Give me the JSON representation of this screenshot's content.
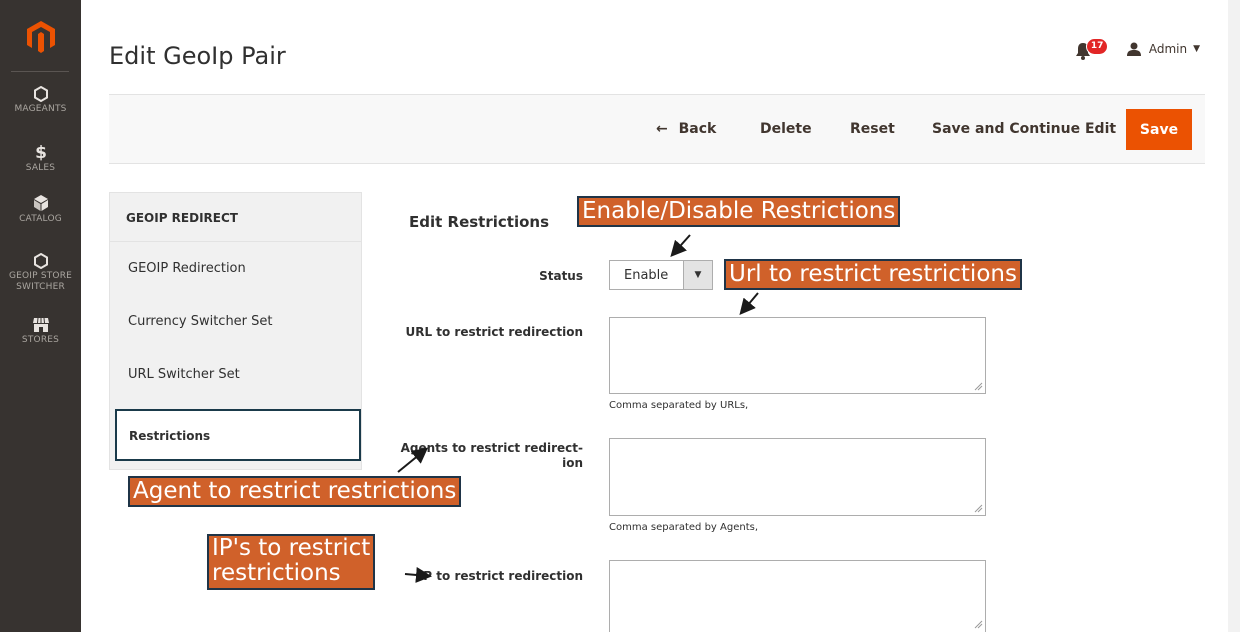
{
  "sidebar_nav": {
    "items": [
      {
        "label": "MAGEANTS",
        "icon": "hexagon-icon"
      },
      {
        "label": "SALES",
        "icon": "dollar-icon"
      },
      {
        "label": "CATALOG",
        "icon": "cube-icon"
      },
      {
        "label": "GEOIP STORE SWITCHER",
        "line1": "GEOIP STORE",
        "line2": "SWITCHER",
        "icon": "hexagon-icon"
      },
      {
        "label": "STORES",
        "icon": "store-icon"
      }
    ]
  },
  "header": {
    "title": "Edit GeoIp Pair",
    "notifications_count": "17",
    "user": "Admin"
  },
  "actions": {
    "back": "Back",
    "delete": "Delete",
    "reset": "Reset",
    "save_continue": "Save and Continue Edit",
    "save": "Save"
  },
  "tabs": {
    "heading": "GEOIP REDIRECT",
    "items": [
      "GEOIP Redirection",
      "Currency Switcher Set",
      "URL Switcher Set",
      "Restrictions"
    ],
    "active": "Restrictions"
  },
  "form": {
    "section_title": "Edit Restrictions",
    "status_label": "Status",
    "status_value": "Enable",
    "url_label": "URL to restrict redirection",
    "url_note": "Comma separated by URLs,",
    "agents_label_line1": "Agents to restrict redirect-",
    "agents_label_line2": "ion",
    "agents_note": "Comma separated by Agents,",
    "ip_label": "IP to restrict redirection"
  },
  "annotations": {
    "enable_disable": "Enable/Disable Restrictions",
    "url": "Url to restrict restrictions",
    "agent": "Agent to restrict restrictions",
    "ip_line1": "IP's to restrict",
    "ip_line2": "restrictions"
  },
  "colors": {
    "rail_bg": "#373330",
    "accent": "#eb5202",
    "callout_bg": "#d0612a"
  }
}
